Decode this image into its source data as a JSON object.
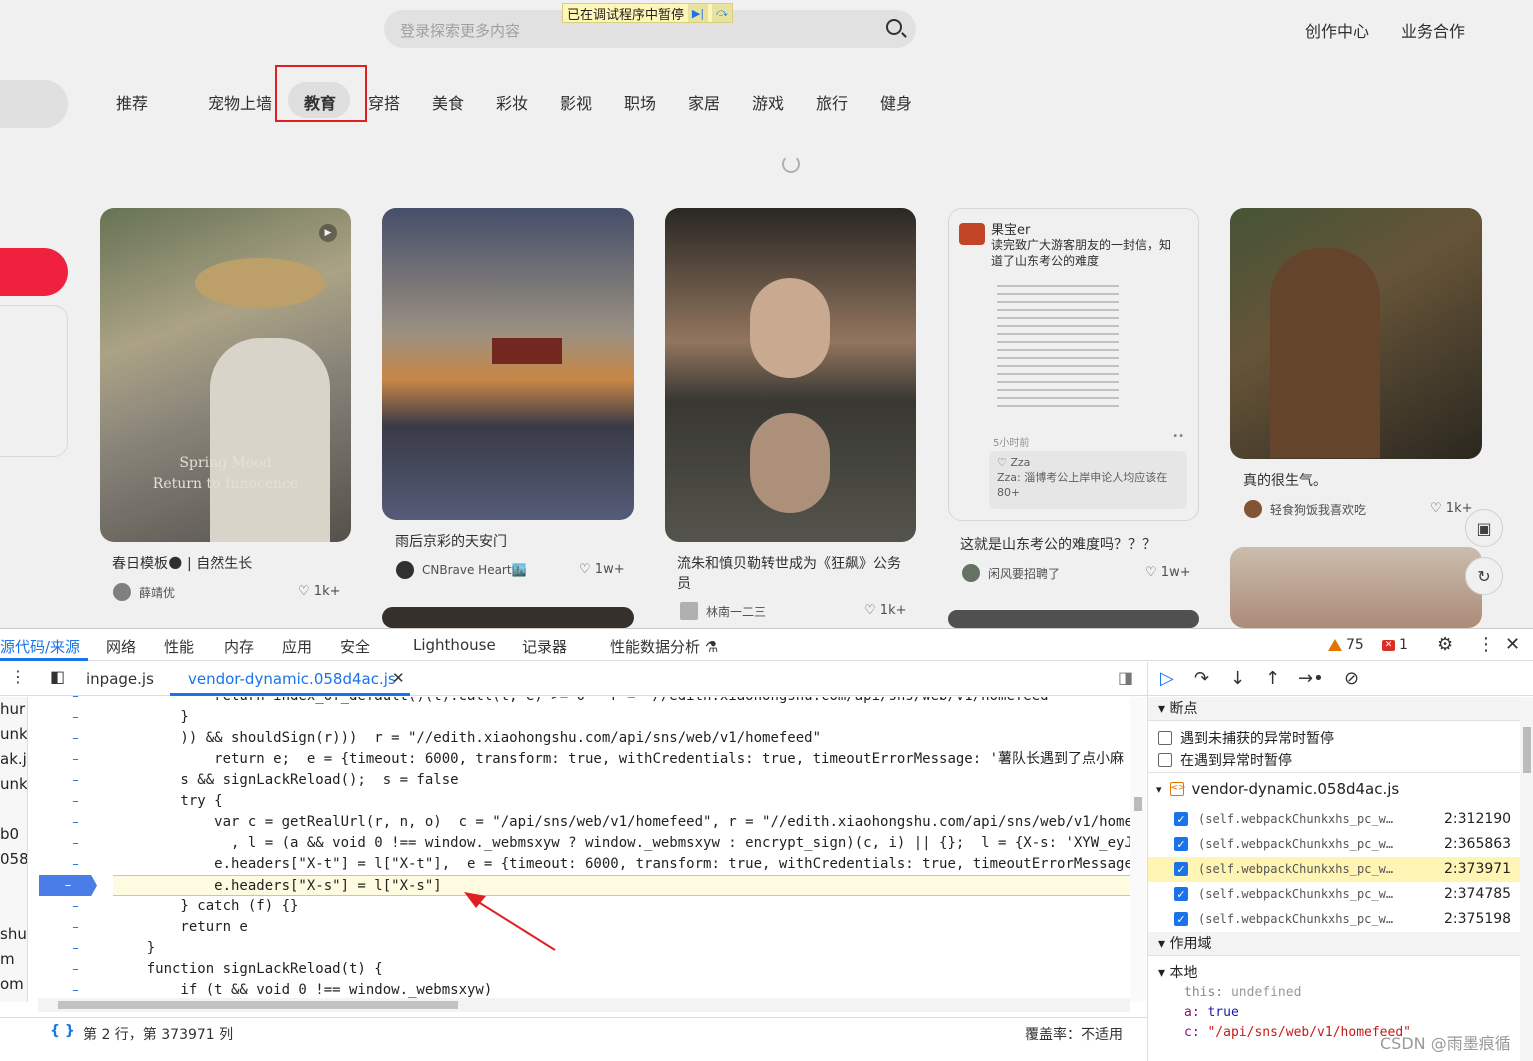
{
  "site": {
    "search_placeholder": "登录探索更多内容",
    "paused_banner": "已在调试程序中暂停",
    "top_links": [
      "创作中心",
      "业务合作"
    ],
    "categories": [
      "推荐",
      "宠物上墙",
      "教育",
      "穿搭",
      "美食",
      "彩妆",
      "影视",
      "职场",
      "家居",
      "游戏",
      "旅行",
      "健身"
    ],
    "active_category": "教育",
    "cards": [
      {
        "title": "春日模板🌑 | 自然生长",
        "author": "薛靖优",
        "likes": "1k+",
        "overlay1": "Spring Mood",
        "overlay2": "Return to Innocence"
      },
      {
        "title": "雨后京彩的天安门",
        "author": "CNBrave Heart🏙️",
        "likes": "1w+"
      },
      {
        "title": "流朱和慎贝勒转世成为《狂飙》公务员",
        "author": "林南一二三",
        "likes": "1k+"
      },
      {
        "title": "这就是山东考公的难度吗？？？",
        "author": "闲风要招聘了",
        "likes": "1w+",
        "name": "果宝er",
        "sub": "读完致广大游客朋友的一封信，知道了山东考公的难度",
        "time": "5小时前",
        "comment_user": "♡ Zza",
        "comment": "Zza: 淄博考公上岸申论人均应该在80+"
      },
      {
        "title": "真的很生气。",
        "author": "轻食狗饭我喜欢吃",
        "likes": "1k+"
      }
    ]
  },
  "devtools": {
    "tabs": [
      "源代码/来源",
      "网络",
      "性能",
      "内存",
      "应用",
      "安全",
      "Lighthouse",
      "记录器",
      "性能数据分析 ⚗"
    ],
    "warnings": "75",
    "errors": "1",
    "file_tabs": [
      "inpage.js",
      "vendor-dynamic.058d4ac.js"
    ],
    "nav_files": [
      "hur",
      "unk",
      "ak.js",
      "unk",
      "",
      "b0",
      "058",
      "",
      "",
      "shu",
      "m",
      "om"
    ],
    "code_lines": [
      {
        "text": "            return index_of_default()(t).call(t, e) >= 0   r = \"//edith.xiaohongshu.com/api/sns/web/v1/homefeed\""
      },
      {
        "text": "        }"
      },
      {
        "text": "        )) && shouldSign(r)))  r = \"//edith.xiaohongshu.com/api/sns/web/v1/homefeed\""
      },
      {
        "text": "            return e;  e = {timeout: 6000, transform: true, withCredentials: true, timeoutErrorMessage: '薯队长遇到了点小麻"
      },
      {
        "text": "        s && signLackReload();  s = false"
      },
      {
        "text": "        try {"
      },
      {
        "text": "            var c = getRealUrl(r, n, o)  c = \"/api/sns/web/v1/homefeed\", r = \"//edith.xiaohongshu.com/api/sns/web/v1/homef"
      },
      {
        "text": "              , l = (a && void 0 !== window._webmsxyw ? window._webmsxyw : encrypt_sign)(c, i) || {};  l = {X-s: 'XYW_eyJz"
      },
      {
        "text": "            e.headers[\"X-t\"] = l[\"X-t\"],  e = {timeout: 6000, transform: true, withCredentials: true, timeoutErrorMessage:"
      },
      {
        "text": "            e.headers[\"X-s\"] = l[\"X-s\"]"
      },
      {
        "text": "        } catch (f) {}"
      },
      {
        "text": "        return e"
      },
      {
        "text": "    }"
      },
      {
        "text": "    function signLackReload(t) {"
      },
      {
        "text": "        if (t && void 0 !== window._webmsxyw)"
      }
    ],
    "status_position": "第 2 行，第 373971 列",
    "coverage": "覆盖率：不适用",
    "breakpoints_title": "断点",
    "pause_uncaught": "遇到未捕获的异常时暂停",
    "pause_caught": "在遇到异常时暂停",
    "bp_file": "vendor-dynamic.058d4ac.js",
    "bp_entries": [
      {
        "text": "(self.webpackChunkxhs_pc_w…",
        "line": "2:312190"
      },
      {
        "text": "(self.webpackChunkxhs_pc_w…",
        "line": "2:365863"
      },
      {
        "text": "(self.webpackChunkxhs_pc_w…",
        "line": "2:373971"
      },
      {
        "text": "(self.webpackChunkxhs_pc_w…",
        "line": "2:374785"
      },
      {
        "text": "(self.webpackChunkxhs_pc_w…",
        "line": "2:375198"
      }
    ],
    "scope_title": "作用域",
    "local_title": "本地",
    "scope_vars": [
      {
        "k": "this",
        "v": "undefined"
      },
      {
        "k": "a",
        "v": "true"
      },
      {
        "k": "c",
        "v": "\"/api/sns/web/v1/homefeed\""
      }
    ]
  },
  "watermark": "CSDN @雨墨痕循"
}
